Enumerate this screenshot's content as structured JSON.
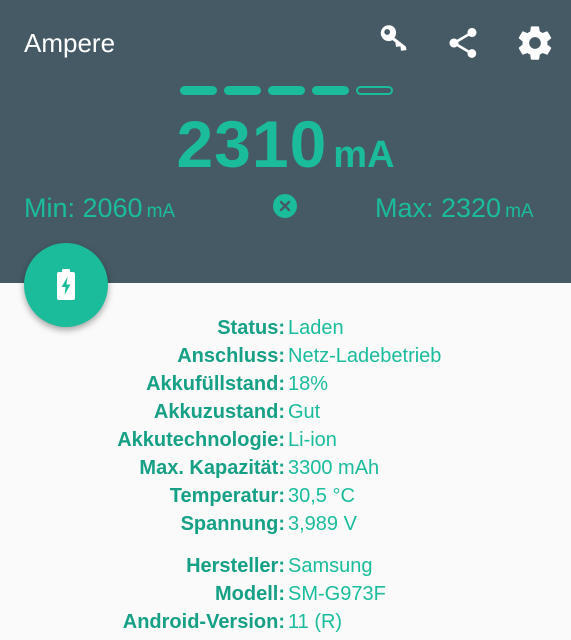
{
  "app": {
    "title": "Ampere"
  },
  "toolbar": {
    "icons": [
      "key-icon",
      "share-icon",
      "gear-icon"
    ]
  },
  "level_indicator": {
    "filled": 4,
    "total": 5
  },
  "current": {
    "value": "2310",
    "unit": "mA"
  },
  "min": {
    "label": "Min: 2060",
    "unit": "mA"
  },
  "max": {
    "label": "Max: 2320",
    "unit": "mA"
  },
  "colors": {
    "accent": "#1abc9c",
    "header": "#455a64",
    "label": "#16a085",
    "background": "#fafafa"
  },
  "battery_info": [
    {
      "label": "Status:",
      "value": "Laden"
    },
    {
      "label": "Anschluss:",
      "value": "Netz-Ladebetrieb"
    },
    {
      "label": "Akkufüllstand:",
      "value": "18%"
    },
    {
      "label": "Akkuzustand:",
      "value": "Gut"
    },
    {
      "label": "Akkutechnologie:",
      "value": "Li-ion"
    },
    {
      "label": "Max. Kapazität:",
      "value": "3300 mAh"
    },
    {
      "label": "Temperatur:",
      "value": "30,5 °C"
    },
    {
      "label": "Spannung:",
      "value": "3,989 V"
    }
  ],
  "device_info": [
    {
      "label": "Hersteller:",
      "value": "Samsung"
    },
    {
      "label": "Modell:",
      "value": "SM-G973F"
    },
    {
      "label": "Android-Version:",
      "value": "11 (R)"
    }
  ]
}
